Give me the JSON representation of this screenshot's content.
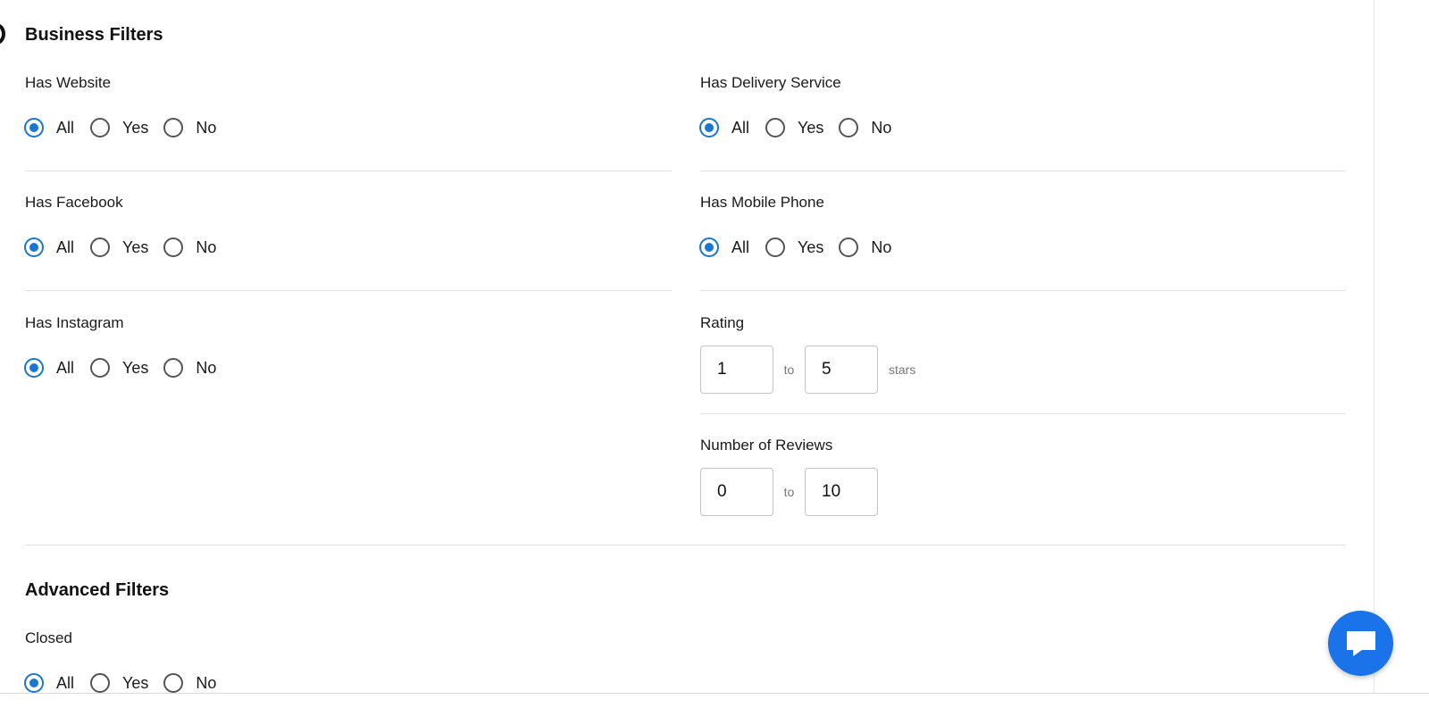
{
  "business_filters": {
    "title": "Business Filters",
    "has_website": {
      "label": "Has Website",
      "options": [
        "All",
        "Yes",
        "No"
      ],
      "selected": "All"
    },
    "has_delivery_service": {
      "label": "Has Delivery Service",
      "options": [
        "All",
        "Yes",
        "No"
      ],
      "selected": "All"
    },
    "has_facebook": {
      "label": "Has Facebook",
      "options": [
        "All",
        "Yes",
        "No"
      ],
      "selected": "All"
    },
    "has_mobile_phone": {
      "label": "Has Mobile Phone",
      "options": [
        "All",
        "Yes",
        "No"
      ],
      "selected": "All"
    },
    "has_instagram": {
      "label": "Has Instagram",
      "options": [
        "All",
        "Yes",
        "No"
      ],
      "selected": "All"
    },
    "rating": {
      "label": "Rating",
      "min": "1",
      "max": "5",
      "separator": "to",
      "unit": "stars"
    },
    "number_of_reviews": {
      "label": "Number of Reviews",
      "min": "0",
      "max": "10",
      "separator": "to"
    }
  },
  "advanced_filters": {
    "title": "Advanced Filters",
    "closed": {
      "label": "Closed",
      "options": [
        "All",
        "Yes",
        "No"
      ],
      "selected": "All"
    }
  },
  "chat": {
    "icon": "chat-bubble-icon"
  },
  "colors": {
    "accent": "#1976d2",
    "chat_button": "#1a73e8",
    "divider": "#e2e2e2"
  }
}
